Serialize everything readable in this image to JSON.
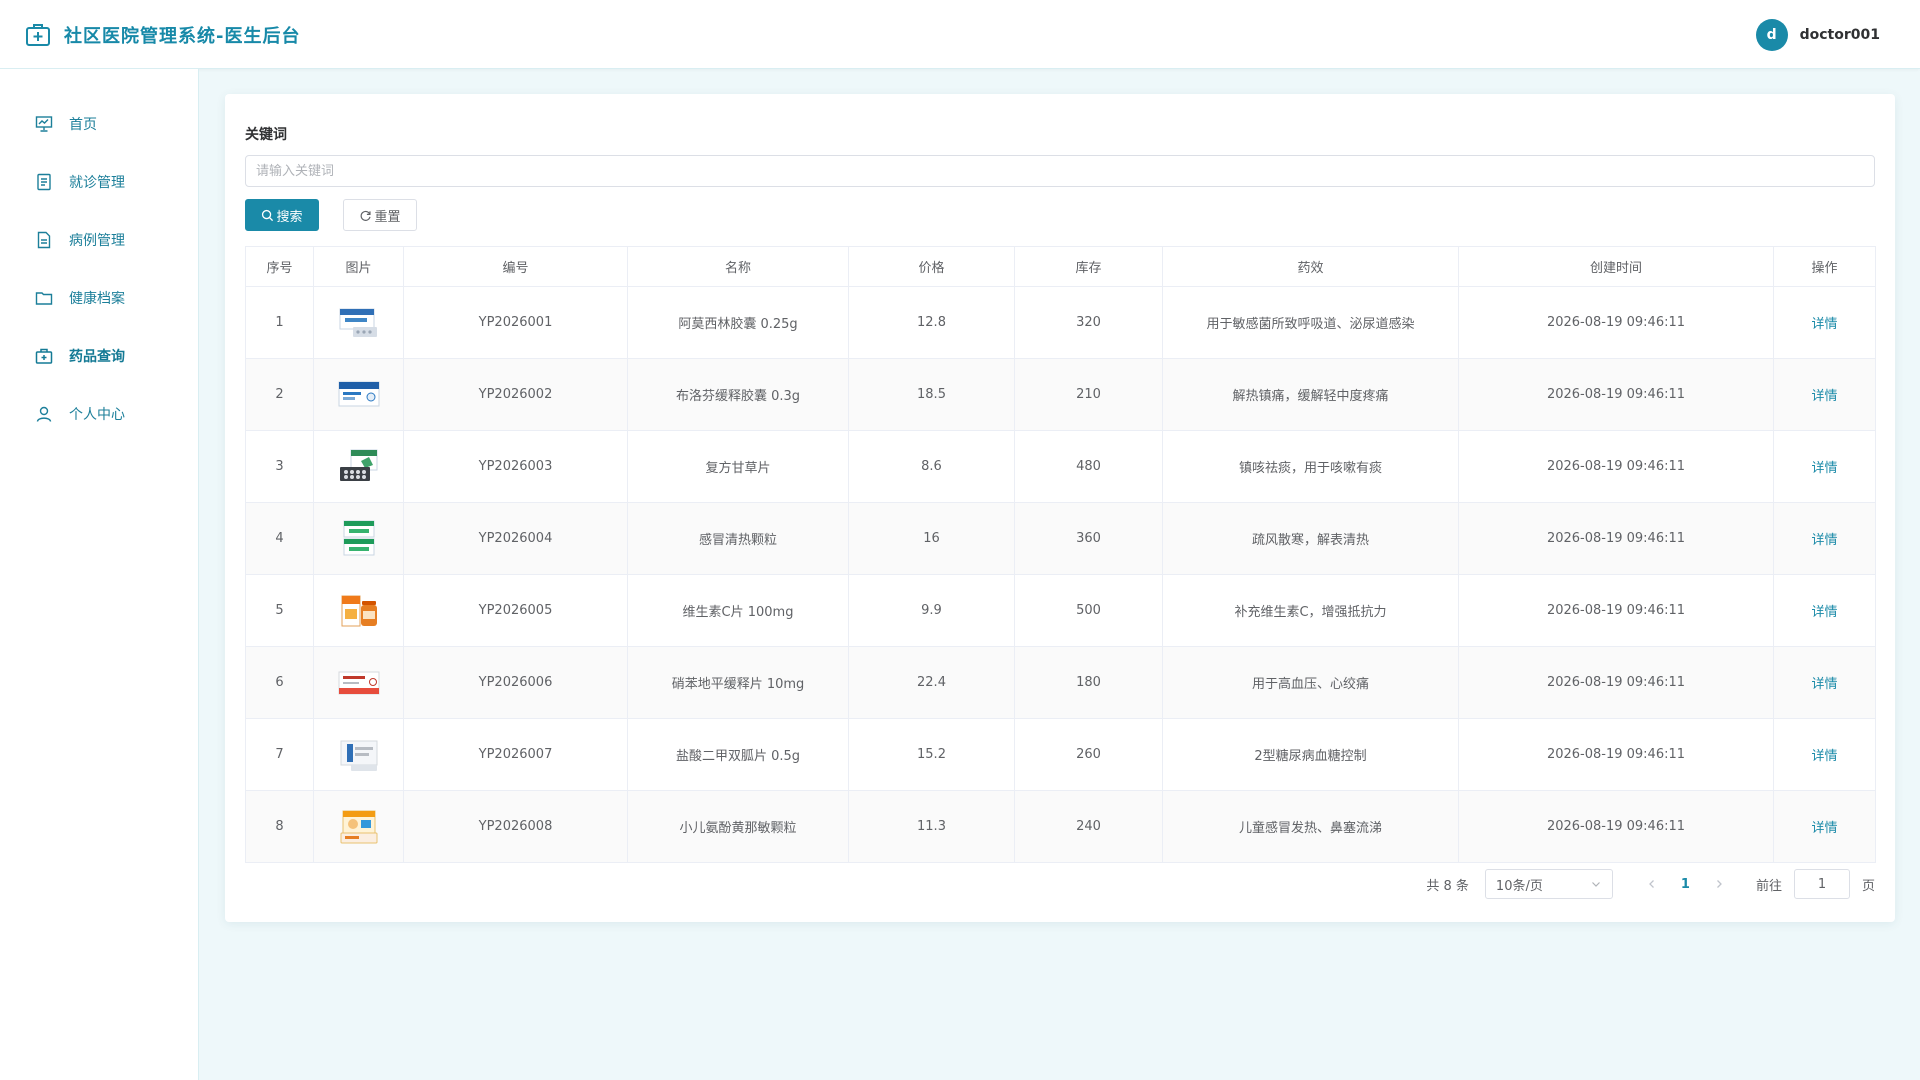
{
  "app": {
    "title": "社区医院管理系统-医生后台",
    "user": {
      "avatar_letter": "d",
      "name": "doctor001"
    }
  },
  "sidebar": {
    "items": [
      {
        "label": "首页",
        "icon": "dashboard-icon"
      },
      {
        "label": "就诊管理",
        "icon": "document-icon"
      },
      {
        "label": "病例管理",
        "icon": "file-icon"
      },
      {
        "label": "健康档案",
        "icon": "folder-icon"
      },
      {
        "label": "药品查询",
        "icon": "medicine-kit-icon"
      },
      {
        "label": "个人中心",
        "icon": "user-icon"
      }
    ],
    "active": "药品查询"
  },
  "search": {
    "label": "关键词",
    "placeholder": "请输入关键词",
    "value": "",
    "search_label": "搜索",
    "reset_label": "重置"
  },
  "table": {
    "headers": [
      "序号",
      "图片",
      "编号",
      "名称",
      "价格",
      "库存",
      "药效",
      "创建时间",
      "操作"
    ],
    "action_label": "详情",
    "rows": [
      {
        "index": "1",
        "code": "YP2026001",
        "name": "阿莫西林胶囊 0.25g",
        "price": "12.8",
        "stock": "320",
        "effect": "用于敏感菌所致呼吸道、泌尿道感染",
        "created": "2026-08-19 09:46:11"
      },
      {
        "index": "2",
        "code": "YP2026002",
        "name": "布洛芬缓释胶囊 0.3g",
        "price": "18.5",
        "stock": "210",
        "effect": "解热镇痛，缓解轻中度疼痛",
        "created": "2026-08-19 09:46:11"
      },
      {
        "index": "3",
        "code": "YP2026003",
        "name": "复方甘草片",
        "price": "8.6",
        "stock": "480",
        "effect": "镇咳祛痰，用于咳嗽有痰",
        "created": "2026-08-19 09:46:11"
      },
      {
        "index": "4",
        "code": "YP2026004",
        "name": "感冒清热颗粒",
        "price": "16",
        "stock": "360",
        "effect": "疏风散寒，解表清热",
        "created": "2026-08-19 09:46:11"
      },
      {
        "index": "5",
        "code": "YP2026005",
        "name": "维生素C片 100mg",
        "price": "9.9",
        "stock": "500",
        "effect": "补充维生素C，增强抵抗力",
        "created": "2026-08-19 09:46:11"
      },
      {
        "index": "6",
        "code": "YP2026006",
        "name": "硝苯地平缓释片 10mg",
        "price": "22.4",
        "stock": "180",
        "effect": "用于高血压、心绞痛",
        "created": "2026-08-19 09:46:11"
      },
      {
        "index": "7",
        "code": "YP2026007",
        "name": "盐酸二甲双胍片 0.5g",
        "price": "15.2",
        "stock": "260",
        "effect": "2型糖尿病血糖控制",
        "created": "2026-08-19 09:46:11"
      },
      {
        "index": "8",
        "code": "YP2026008",
        "name": "小儿氨酚黄那敏颗粒",
        "price": "11.3",
        "stock": "240",
        "effect": "儿童感冒发热、鼻塞流涕",
        "created": "2026-08-19 09:46:11"
      }
    ]
  },
  "pagination": {
    "total_text": "共 8 条",
    "page_size": "10条/页",
    "current_page": "1",
    "goto_prefix": "前往",
    "goto_value": "1",
    "goto_suffix": "页"
  },
  "colors": {
    "primary": "#1a8aa8",
    "background": "#eef8fa",
    "nav_text": "#1c7f9a"
  }
}
